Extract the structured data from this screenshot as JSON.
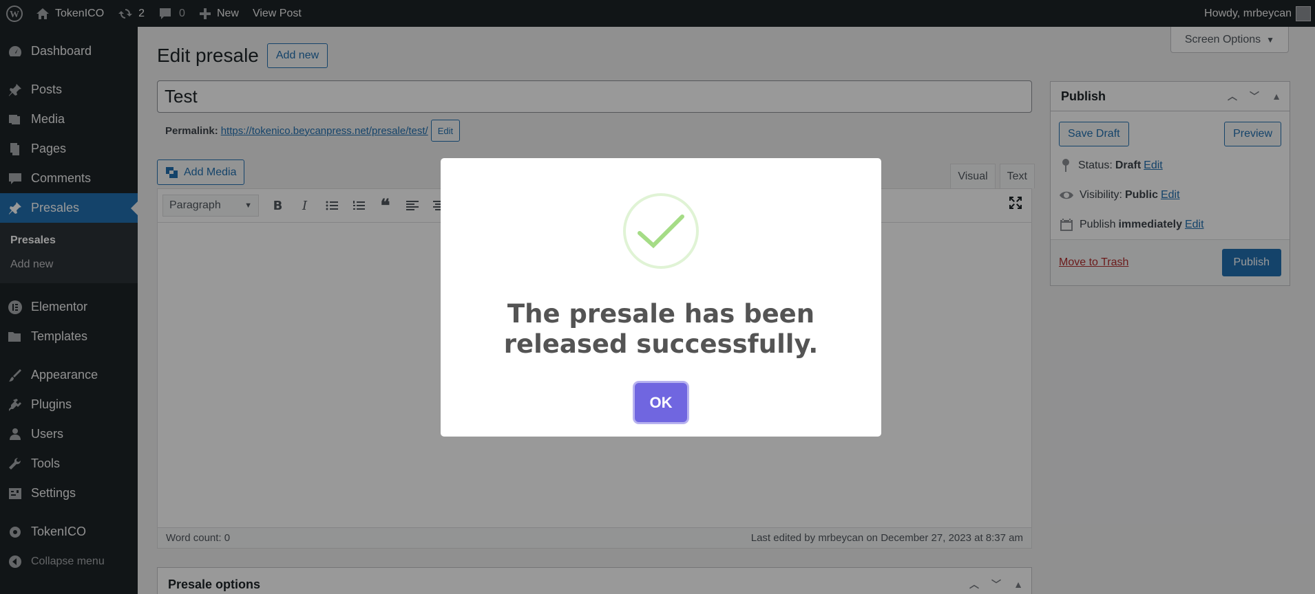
{
  "adminbar": {
    "site_name": "TokenICO",
    "updates_count": "2",
    "comments_count": "0",
    "new_label": "New",
    "view_post_label": "View Post",
    "howdy": "Howdy, mrbeycan"
  },
  "sidebar": {
    "items": [
      {
        "label": "Dashboard",
        "icon": "dashboard-icon"
      },
      {
        "label": "Posts",
        "icon": "pin-icon"
      },
      {
        "label": "Media",
        "icon": "media-icon"
      },
      {
        "label": "Pages",
        "icon": "pages-icon"
      },
      {
        "label": "Comments",
        "icon": "comment-icon"
      },
      {
        "label": "Presales",
        "icon": "pin-icon"
      },
      {
        "label": "Elementor",
        "icon": "elementor-icon"
      },
      {
        "label": "Templates",
        "icon": "folder-icon"
      },
      {
        "label": "Appearance",
        "icon": "brush-icon"
      },
      {
        "label": "Plugins",
        "icon": "plugin-icon"
      },
      {
        "label": "Users",
        "icon": "user-icon"
      },
      {
        "label": "Tools",
        "icon": "wrench-icon"
      },
      {
        "label": "Settings",
        "icon": "settings-icon"
      },
      {
        "label": "TokenICO",
        "icon": "gear-icon"
      }
    ],
    "submenu": [
      "Presales",
      "Add new"
    ],
    "collapse_label": "Collapse menu"
  },
  "header": {
    "screen_options": "Screen Options",
    "page_title": "Edit presale",
    "add_new": "Add new"
  },
  "post": {
    "title": "Test",
    "permalink_label": "Permalink:",
    "permalink_url": "https://tokenico.beycanpress.net/presale/test/",
    "edit_label": "Edit"
  },
  "editor": {
    "add_media": "Add Media",
    "tab_visual": "Visual",
    "tab_text": "Text",
    "format": "Paragraph",
    "word_count": "Word count: 0",
    "last_edited": "Last edited by mrbeycan on December 27, 2023 at 8:37 am"
  },
  "presale_options": {
    "title": "Presale options"
  },
  "publish": {
    "title": "Publish",
    "save_draft": "Save Draft",
    "preview": "Preview",
    "status_label": "Status:",
    "status_value": "Draft",
    "visibility_label": "Visibility:",
    "visibility_value": "Public",
    "publish_label": "Publish",
    "publish_value": "immediately",
    "edit": "Edit",
    "move_to_trash": "Move to Trash",
    "publish_button": "Publish"
  },
  "modal": {
    "message": "The presale has been released successfully.",
    "ok": "OK"
  },
  "colors": {
    "primary": "#2271b1",
    "sidebar": "#1d2327",
    "ok_button": "#7066e0",
    "success": "#a5dc86",
    "trash": "#b32d2e"
  }
}
